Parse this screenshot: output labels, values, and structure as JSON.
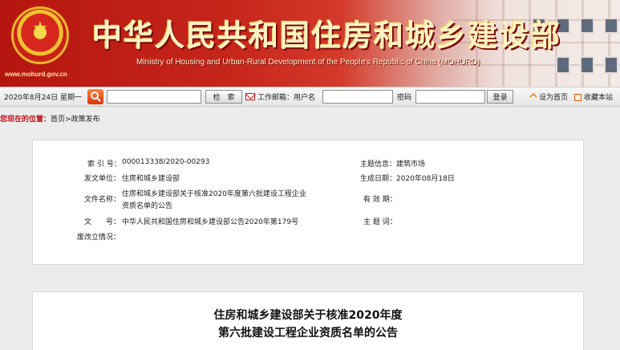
{
  "banner": {
    "title": "中华人民共和国住房和城乡建设部",
    "subtitle": "Ministry of Housing and Urban-Rural Development of the People's Republic of China (MOHURD)",
    "url": "www.mohurd.gov.cn",
    "emblem_icon": "national-emblem-icon",
    "primary_color": "#c7261b"
  },
  "toolbar": {
    "date": "2020年8月24日 星期一",
    "search_placeholder": "",
    "search_button": "检　索",
    "mail_label": "工作邮箱：用户名",
    "username_value": "",
    "password_label": "密码",
    "password_value": "",
    "login_button": "登录",
    "set_home": "设为首页",
    "favorite": "收藏本站"
  },
  "breadcrumb": {
    "prefix": "您现在的位置：",
    "home": "首页",
    "sep": ">",
    "current": "政策发布"
  },
  "info": {
    "index_label": "索 引 号：",
    "index_value": "000013338/2020-00293",
    "topic_label": "主题信息：",
    "topic_value": "建筑市场",
    "issuer_label": "发文单位：",
    "issuer_value": "住房和城乡建设部",
    "date_label": "生成日期：",
    "date_value": "2020年08月18日",
    "filename_label": "文件名称：",
    "filename_line1": "住房和城乡建设部关于核准2020年度第六批建设工程企业",
    "filename_line2": "资质名单的公告",
    "validity_label": "有 效 期：",
    "validity_value": "",
    "docno_label": "文　　号：",
    "docno_value": "中华人民共和国住房和城乡建设部公告2020年第179号",
    "keywords_label": "主 题 词：",
    "keywords_value": "",
    "status_label": "废改立情况：",
    "status_value": ""
  },
  "article": {
    "title_line1": "住房和城乡建设部关于核准2020年度",
    "title_line2": "第六批建设工程企业资质名单的公告"
  }
}
